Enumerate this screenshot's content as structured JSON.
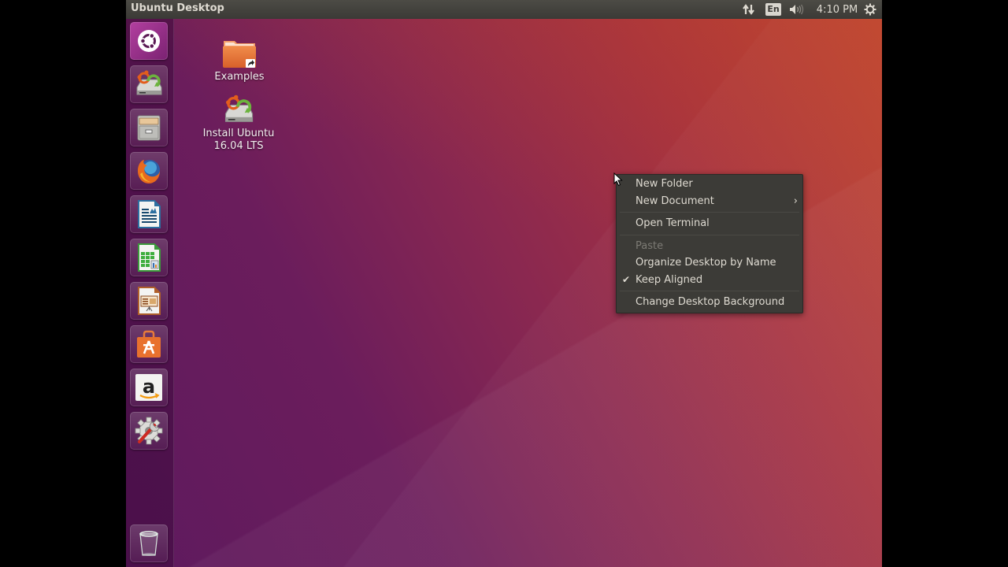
{
  "top_panel": {
    "window_title": "Ubuntu Desktop",
    "indicators": {
      "network_icon": "network-updown-arrows-icon",
      "keyboard_layout": "En",
      "sound_icon": "speaker-volume-icon",
      "clock": "4:10 PM",
      "session_icon": "gear-power-icon"
    }
  },
  "launcher": {
    "items": [
      {
        "name": "Dash Home",
        "icon": "ubuntu-logo-icon"
      },
      {
        "name": "Install Ubuntu 16.04 LTS",
        "icon": "installer-drive-icon"
      },
      {
        "name": "Files",
        "icon": "file-cabinet-icon"
      },
      {
        "name": "Firefox Web Browser",
        "icon": "firefox-icon"
      },
      {
        "name": "LibreOffice Writer",
        "icon": "writer-document-icon"
      },
      {
        "name": "LibreOffice Calc",
        "icon": "calc-spreadsheet-icon"
      },
      {
        "name": "LibreOffice Impress",
        "icon": "impress-presentation-icon"
      },
      {
        "name": "Ubuntu Software",
        "icon": "software-bag-icon"
      },
      {
        "name": "Amazon",
        "icon": "amazon-icon"
      },
      {
        "name": "System Settings",
        "icon": "settings-gear-wrench-icon"
      }
    ],
    "trash": {
      "name": "Trash",
      "icon": "trash-icon"
    }
  },
  "desktop": {
    "icons": [
      {
        "label": "Examples",
        "icon": "folder-link-icon"
      },
      {
        "label_line1": "Install Ubuntu",
        "label_line2": "16.04 LTS",
        "icon": "installer-drive-icon"
      }
    ]
  },
  "context_menu": {
    "items": [
      {
        "label": "New Folder",
        "enabled": true
      },
      {
        "label": "New Document",
        "enabled": true,
        "submenu": true
      },
      {
        "label": "Open Terminal",
        "enabled": true
      },
      {
        "label": "Paste",
        "enabled": false
      },
      {
        "label": "Organize Desktop by Name",
        "enabled": true
      },
      {
        "label": "Keep Aligned",
        "enabled": true,
        "checked": true
      },
      {
        "label": "Change Desktop Background",
        "enabled": true
      }
    ],
    "submenu_arrow": "›",
    "check_mark": "✔"
  },
  "colors": {
    "panel_bg": "#3b3a36",
    "panel_text": "#dfdbd2",
    "menu_bg": "#3c3b37",
    "menu_disabled_text": "#7c7a74",
    "wallpaper_purple": "#6b1d5c",
    "wallpaper_orange": "#c24630"
  }
}
